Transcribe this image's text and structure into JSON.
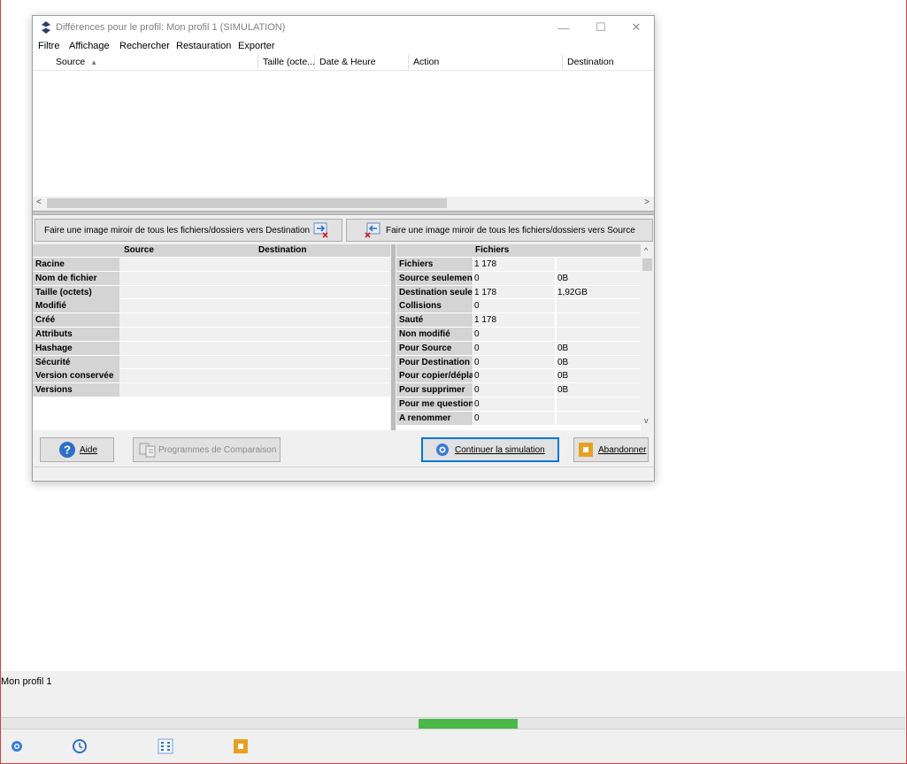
{
  "window": {
    "title": "Différences pour le profil: Mon profil 1 (SIMULATION)",
    "minimize": "—",
    "maximize": "☐",
    "close": "✕"
  },
  "menu": [
    "Filtre",
    "Affichage",
    "Rechercher",
    "Restauration",
    "Exporter"
  ],
  "file_list": {
    "columns": [
      "Source",
      "Taille (octe...",
      "Date & Heure",
      "Action",
      "Destination"
    ],
    "sort_arrow": "▲",
    "scroll_left": "<",
    "scroll_right": ">"
  },
  "mirror": {
    "to_destination": "Faire une image miroir de tous les fichiers/dossiers vers Destination",
    "to_source": "Faire une image miroir de tous les fichiers/dossiers vers Source"
  },
  "properties": {
    "headers": [
      "Source",
      "Destination"
    ],
    "rows": [
      "Racine",
      "Nom de fichier",
      "Taille (octets)",
      "Modifié",
      "Créé",
      "Attributs",
      "Hashage",
      "Sécurité",
      "Version conservée",
      "Versions"
    ]
  },
  "stats": {
    "header": "Fichiers",
    "rows": [
      {
        "label": "Fichiers",
        "v1": "1 178",
        "v2": ""
      },
      {
        "label": "Source seulement",
        "v1": "0",
        "v2": "0B"
      },
      {
        "label": "Destination seulement",
        "v1": "1 178",
        "v2": "1,92GB"
      },
      {
        "label": "Collisions",
        "v1": "0",
        "v2": ""
      },
      {
        "label": "Sauté",
        "v1": "1 178",
        "v2": ""
      },
      {
        "label": "Non modifié",
        "v1": "0",
        "v2": ""
      },
      {
        "label": "Pour Source",
        "v1": "0",
        "v2": "0B"
      },
      {
        "label": "Pour Destination",
        "v1": "0",
        "v2": "0B"
      },
      {
        "label": "Pour copier/déplacer",
        "v1": "0",
        "v2": "0B"
      },
      {
        "label": "Pour supprimer",
        "v1": "0",
        "v2": "0B"
      },
      {
        "label": "Pour me questionner",
        "v1": "0",
        "v2": ""
      },
      {
        "label": "A renommer",
        "v1": "0",
        "v2": ""
      }
    ],
    "scroll_up": "^",
    "scroll_down": "v"
  },
  "buttons": {
    "help": "Aide",
    "compare": "Programmes de Comparaison",
    "continue": "Continuer la simulation",
    "abort": "Abandonner"
  },
  "background": {
    "profile_name": "Mon profil 1",
    "progress": 0.11
  },
  "colors": {
    "accent": "#0078d7",
    "progress": "#4cb848",
    "abort_icon": "#e8a020",
    "help_icon": "#2e6fc7"
  }
}
